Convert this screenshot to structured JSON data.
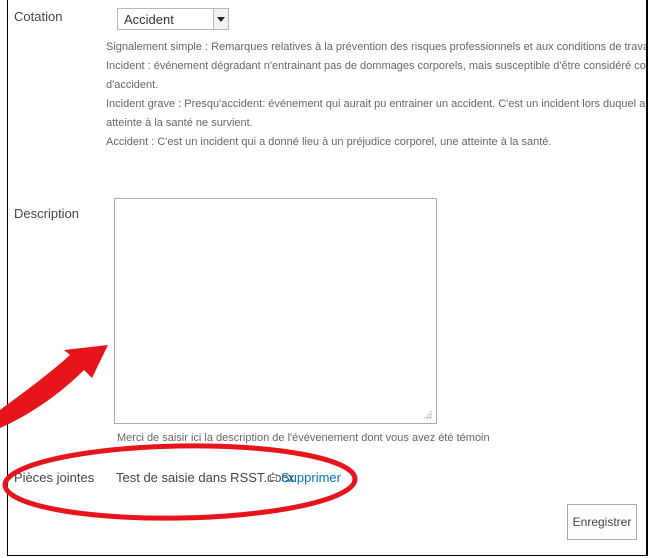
{
  "form": {
    "cotation": {
      "label": "Cotation",
      "selected": "Accident",
      "help_lines": [
        "Signalement simple : Remarques relatives à la prévention des risques professionnels et aux conditions de travail.",
        "Incident : événement dégradant n'entrainant pas de dommages corporels, mais susceptible d'être considéré comme précurseur",
        "d'accident.",
        "Incident grave : Presqu'accident: événement qui aurait pu entrainer un accident. C'est un incident lors duquel aucun préjudice",
        "atteinte à la santé ne survient.",
        "Accident : C'est un incident qui a donné lieu à un préjudice corporel, une atteinte à la santé."
      ]
    },
    "description": {
      "label": "Description",
      "value": "",
      "hint": "Merci de saisir ici la description de l'évévenement dont vous avez été témoin"
    },
    "attachments": {
      "label": "Pièces jointes",
      "file_name": "Test de saisie dans RSST.docx",
      "delete_label": "Supprimer"
    },
    "save_label": "Enregistrer"
  },
  "annotation": {
    "color": "#e8141c",
    "arrow": "red-curved-arrow",
    "ellipse": "red-ellipse"
  }
}
